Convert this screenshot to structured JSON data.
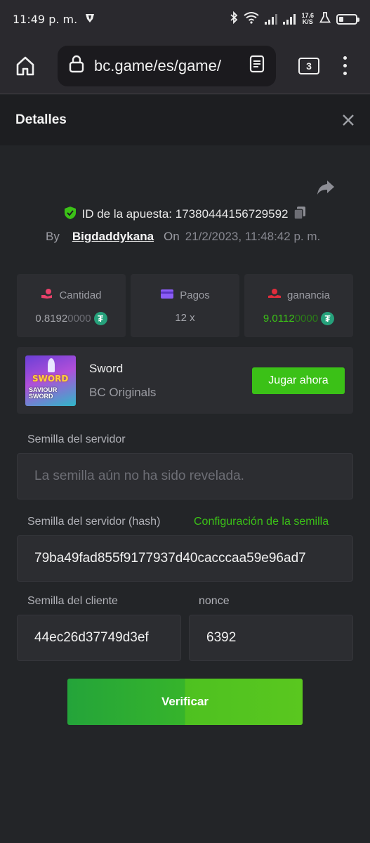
{
  "status_bar": {
    "time": "11:49 p. m.",
    "speed_top": "17.6",
    "speed_bottom": "K/S"
  },
  "browser": {
    "url": "bc.game/es/game/",
    "tab_count": "3"
  },
  "modal": {
    "title": "Detalles"
  },
  "bet": {
    "id_label": "ID de la apuesta: 17380444156729592",
    "by_label": "By",
    "username": "Bigdaddykana",
    "on_label": "On",
    "date": "21/2/2023, 11:48:42 p. m."
  },
  "stats": [
    {
      "label": "Cantidad",
      "value_main": "0.8192",
      "value_dim": "0000",
      "icon": "coin-hand-icon",
      "color": "#e9416a"
    },
    {
      "label": "Pagos",
      "value_main": "12 x",
      "value_dim": "",
      "icon": "card-icon",
      "color": "#8b5cf6"
    },
    {
      "label": "ganancia",
      "value_main": "9.0112",
      "value_dim": "0000",
      "icon": "profit-hand-icon",
      "color": "#e02d3c"
    }
  ],
  "coin_symbol": "₮",
  "game": {
    "name": "Sword",
    "provider": "BC Originals",
    "play_label": "Jugar ahora",
    "thumb_line1": "SWORD",
    "thumb_line2": "SAVIOUR SWORD"
  },
  "seeds": {
    "server_label": "Semilla del servidor",
    "server_placeholder": "La semilla aún no ha sido revelada.",
    "server_hash_label": "Semilla del servidor (hash)",
    "seed_config_link": "Configuración de la semilla",
    "server_hash_value": "79ba49fad855f9177937d40cacccaa59e96ad7",
    "client_label": "Semilla del cliente",
    "client_value": "44ec26d37749d3ef",
    "nonce_label": "nonce",
    "nonce_value": "6392"
  },
  "verify_label": "Verificar",
  "colors": {
    "accent_green": "#3bc117",
    "background": "#232528",
    "card": "#2c2d31"
  }
}
